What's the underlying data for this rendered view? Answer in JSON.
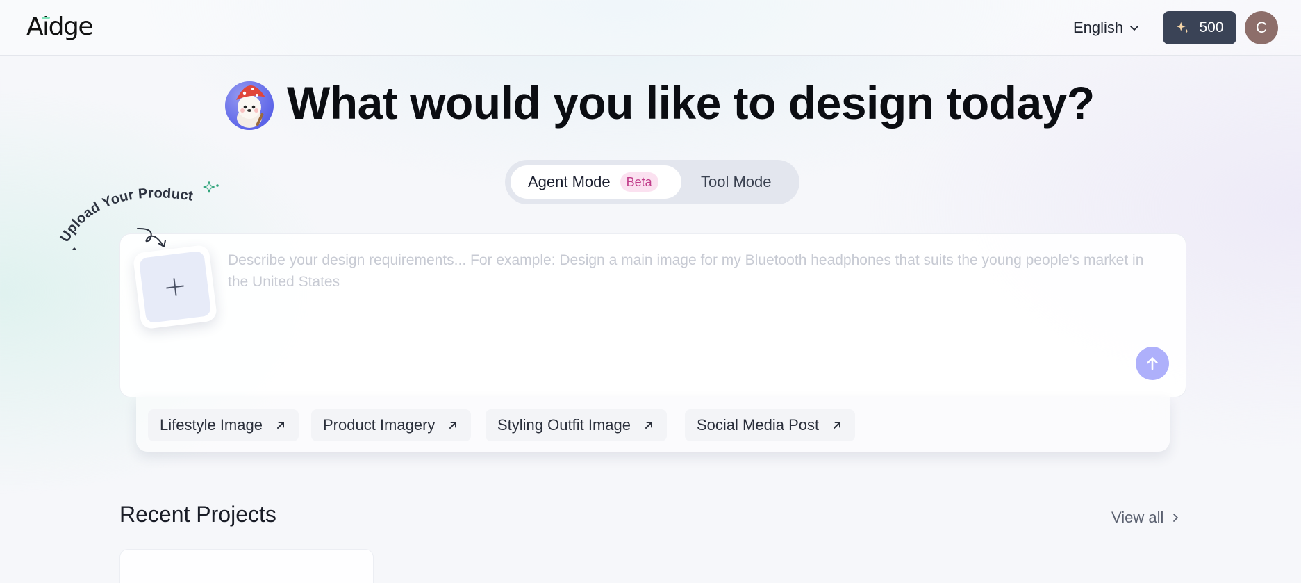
{
  "header": {
    "logo_text": "Aidge",
    "language": "English",
    "credits": "500",
    "avatar_initial": "C",
    "icons": {
      "language_chevron": "chevron-down-icon",
      "credits": "sparkle-icon"
    }
  },
  "hero": {
    "title": "What would you like to design today?",
    "mascot": "mascot-icon"
  },
  "modes": {
    "agent_label": "Agent Mode",
    "agent_badge": "Beta",
    "tool_label": "Tool Mode",
    "active": "Agent Mode"
  },
  "upload": {
    "label": "Upload Your Product",
    "icon": "plus-icon"
  },
  "prompt": {
    "value": "",
    "placeholder": "Describe your design requirements... For example: Design a main image for my Bluetooth headphones that suits the young people's market in the United States",
    "send_icon": "arrow-up-icon"
  },
  "suggestions": [
    {
      "label": "Lifestyle Image",
      "icon": "arrow-up-right-icon"
    },
    {
      "label": "Product Imagery",
      "icon": "arrow-up-right-icon"
    },
    {
      "label": "Styling Outfit Image",
      "icon": "arrow-up-right-icon"
    },
    {
      "label": "Social Media Post",
      "icon": "arrow-up-right-icon"
    }
  ],
  "recent": {
    "title": "Recent Projects",
    "view_all": "View all"
  },
  "colors": {
    "credits_bg": "#3a4356",
    "send_button": "#aeb0fb",
    "beta_badge_bg": "#fbe1f0",
    "beta_badge_text": "#c13d8a",
    "avatar_bg": "#8d6e6a",
    "toggle_bg": "#e3e6ee"
  }
}
